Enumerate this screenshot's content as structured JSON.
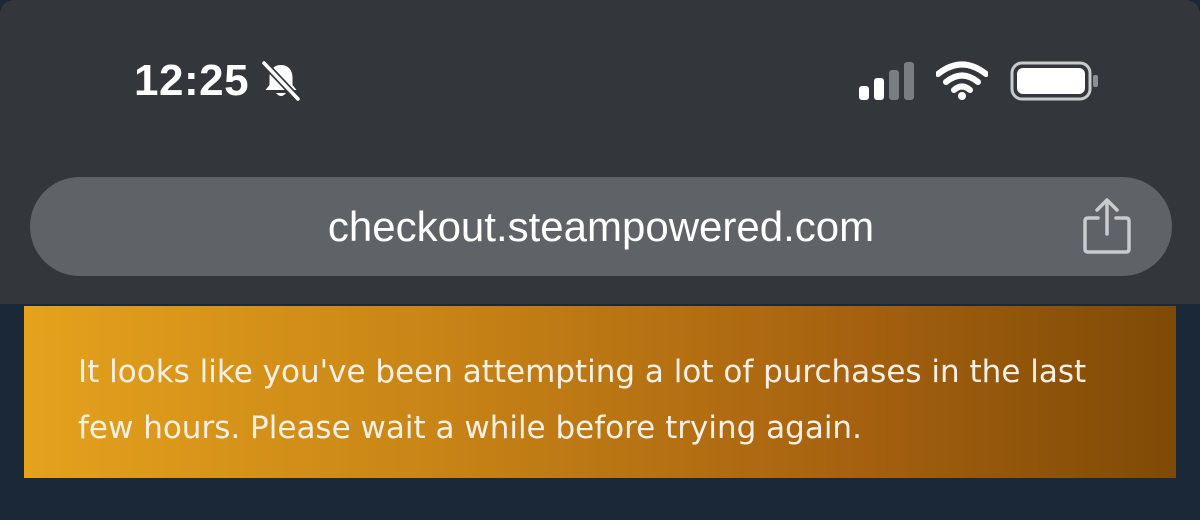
{
  "status_bar": {
    "time": "12:25",
    "silent_mode_icon": "bell-slash-icon",
    "signal_icon": "cellular-signal-icon",
    "signal_strength_bars": 2,
    "wifi_icon": "wifi-icon",
    "battery_icon": "battery-icon",
    "battery_level": 1.0
  },
  "browser": {
    "url": "checkout.steampowered.com",
    "share_icon": "share-icon"
  },
  "alert": {
    "message": "It looks like you've been attempting a lot of purchases in the last few hours. Please wait a while before trying again."
  },
  "colors": {
    "chrome_background": "#33373b",
    "url_bar_background": "#5f6367",
    "page_background": "#1b2838",
    "alert_gradient_start": "#e4a21d",
    "alert_gradient_end": "#7f4a06",
    "alert_text": "#f6f0e4"
  }
}
